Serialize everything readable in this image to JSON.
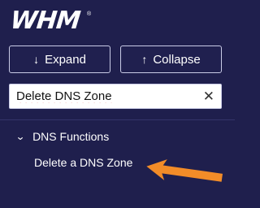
{
  "brand": {
    "logo_text": "WHM",
    "trademark": "®"
  },
  "toolbar": {
    "expand_icon": "↓",
    "expand_label": "Expand",
    "collapse_icon": "↑",
    "collapse_label": "Collapse"
  },
  "search": {
    "value": "Delete DNS Zone",
    "clear_icon": "✕"
  },
  "nav": {
    "category": {
      "label": "DNS Functions",
      "icon": "chevron-down-icon"
    },
    "items": [
      {
        "label": "Delete a DNS Zone"
      }
    ]
  },
  "annotation": {
    "pointer_color": "#f28c28",
    "pointer_icon": "arrow-left-pointer"
  },
  "colors": {
    "sidebar_bg": "#1f1f4d",
    "border": "#c9cbe6",
    "accent": "#f28c28"
  }
}
